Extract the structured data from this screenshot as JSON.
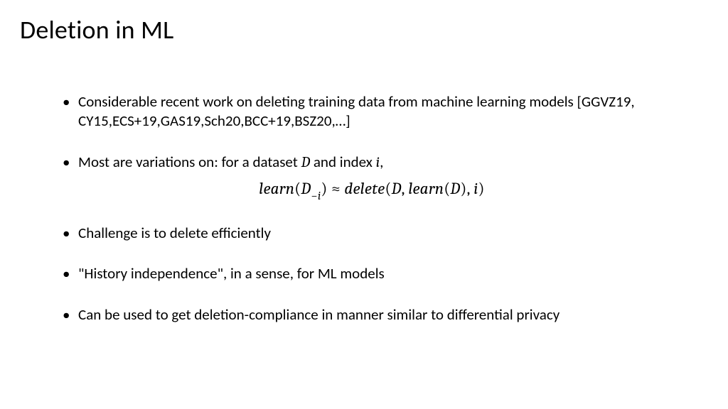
{
  "title": "Deletion in ML",
  "bullets": {
    "b1": "Considerable recent work on deleting training data from machine learning models [GGVZ19, CY15,ECS+19,GAS19,Sch20,BCC+19,BSZ20,…]",
    "b2_prefix": "Most are variations on: for a dataset ",
    "b2_var1": "D",
    "b2_mid": " and index ",
    "b2_var2": "i",
    "b2_suffix": ",",
    "b3": "Challenge is to delete efficiently",
    "b4": "\"History independence\", in a sense, for ML models",
    "b5": "Can be used to get deletion-compliance in manner similar to differential privacy"
  },
  "equation": {
    "learn1": "learn",
    "lp1": "(",
    "D1": "D",
    "sub_minus": "−",
    "sub_i": "i",
    "rp1": ")",
    "approx": " ≈ ",
    "delete": "delete",
    "lp2": "(",
    "D2": "D",
    "comma1": ", ",
    "learn2": "learn",
    "lp3": "(",
    "D3": "D",
    "rp3": ")",
    "comma2": ", ",
    "i2": "i",
    "rp2": ")"
  }
}
